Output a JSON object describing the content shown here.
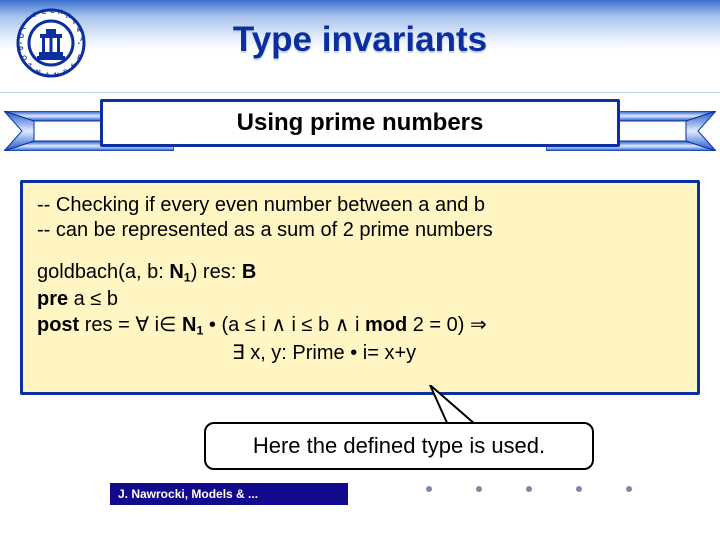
{
  "header": {
    "title": "Type invariants"
  },
  "subtitle": {
    "text": "Using prime numbers"
  },
  "panel": {
    "comment1": "-- Checking if every even number between a and b",
    "comment2": "-- can be represented as a sum of 2 prime numbers",
    "sig_name": "goldbach(a, b: ",
    "sig_type": "N",
    "sig_type_sub": "1",
    "sig_after": ") res: ",
    "sig_res_type": "B",
    "pre_kw": "pre",
    "pre_body": " a ≤ b",
    "post_kw": "post",
    "post_body_1": " res = ∀ i∈ ",
    "post_type": "N",
    "post_type_sub": "1",
    "post_body_2": " • (a ≤ i ∧ i ≤ b ∧ i ",
    "post_mod": "mod",
    "post_body_3": " 2 = 0) ⇒",
    "post_line2": "∃ x, y: Prime • i= x+y"
  },
  "callout": {
    "text": "Here the defined type is used."
  },
  "footer": {
    "text": "J. Nawrocki, Models & ..."
  }
}
